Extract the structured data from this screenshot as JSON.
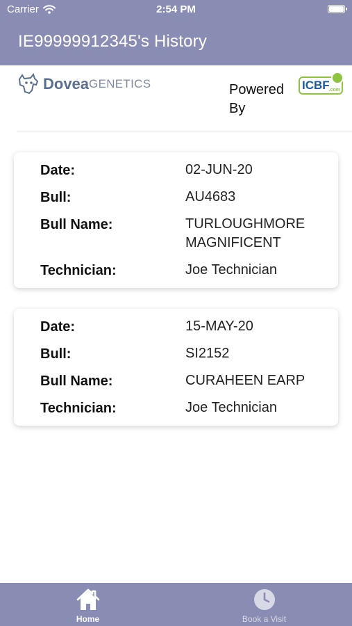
{
  "status_bar": {
    "carrier": "Carrier",
    "time": "2:54 PM"
  },
  "header": {
    "title": "IE99999912345's History",
    "background": "#8a8db3"
  },
  "brand": {
    "dovea_word": "Dovea",
    "genetics_word": "GENETICS",
    "powered_line1": "Powered",
    "powered_line2": "By",
    "icbf_word": "ICBF",
    "icbf_com": ".com"
  },
  "history": [
    {
      "date_label": "Date:",
      "date": "02-JUN-20",
      "bull_label": "Bull:",
      "bull": "AU4683",
      "bull_name_label": "Bull Name:",
      "bull_name": "TURLOUGHMORE MAGNIFICENT",
      "technician_label": "Technician:",
      "technician": "Joe Technician"
    },
    {
      "date_label": "Date:",
      "date": "15-MAY-20",
      "bull_label": "Bull:",
      "bull": "SI2152",
      "bull_name_label": "Bull Name:",
      "bull_name": "CURAHEEN EARP",
      "technician_label": "Technician:",
      "technician": "Joe Technician"
    }
  ],
  "tabbar": {
    "home_label": "Home",
    "home_icon": "house-icon",
    "book_label": "Book a Visit",
    "book_icon": "clock-icon"
  }
}
